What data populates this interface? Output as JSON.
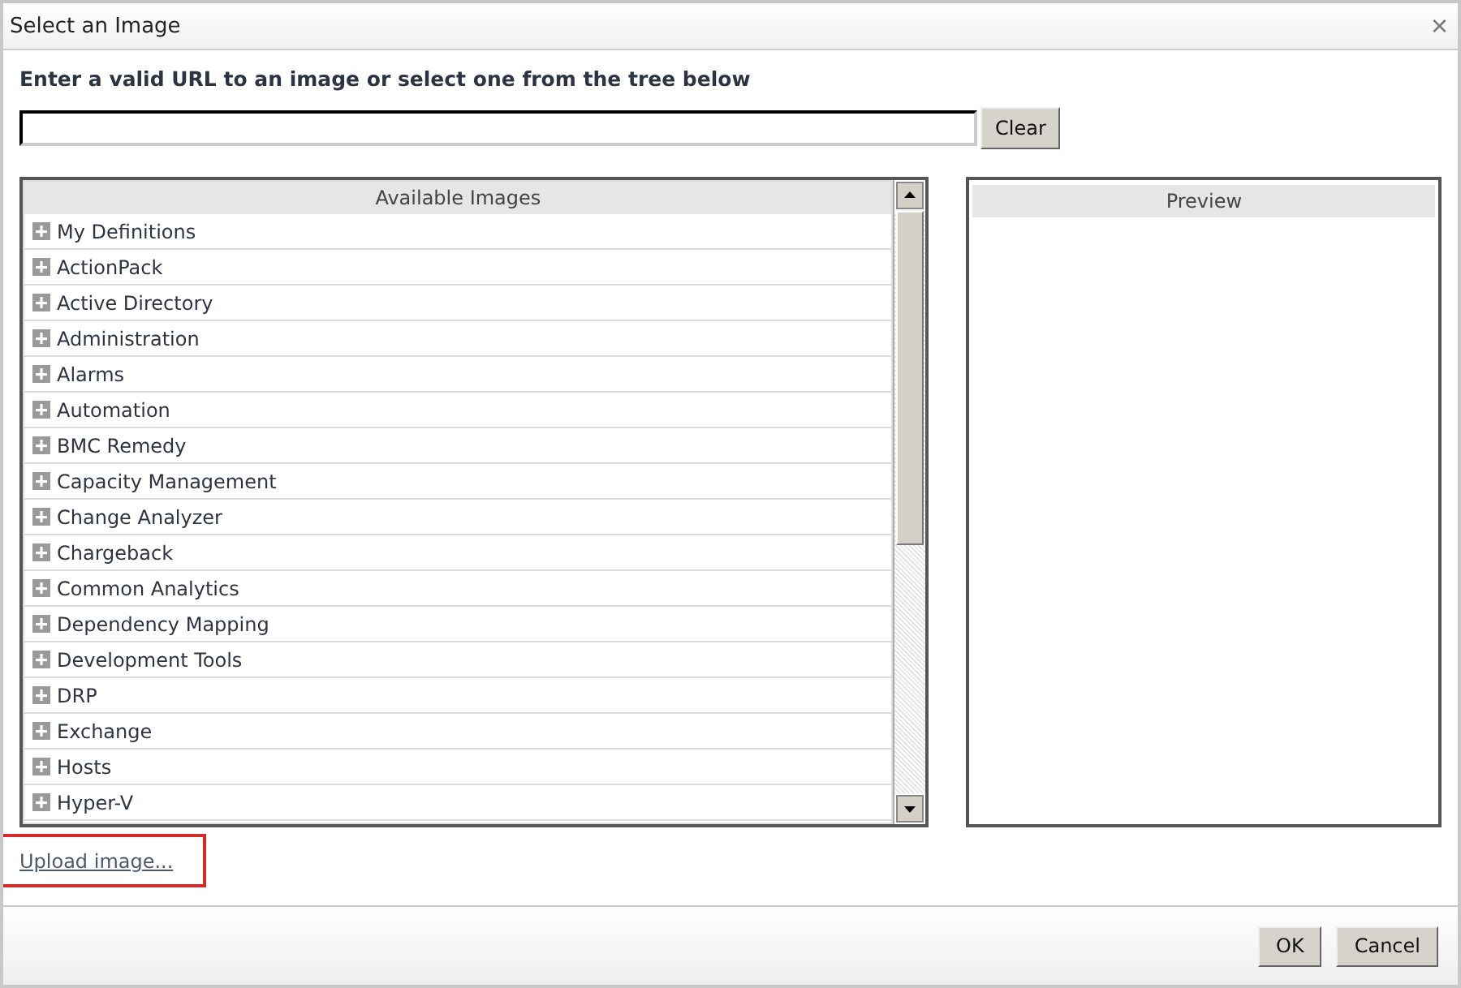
{
  "window": {
    "title": "Select an Image",
    "close": "×"
  },
  "instruction": "Enter a valid URL to an image or select one from the tree below",
  "clear_button": "Clear",
  "tree": {
    "header": "Available Images",
    "items": [
      {
        "label": "My Definitions",
        "expanded": false
      },
      {
        "label": "ActionPack",
        "expanded": false
      },
      {
        "label": "Active Directory",
        "expanded": false
      },
      {
        "label": "Administration",
        "expanded": false
      },
      {
        "label": "Alarms",
        "expanded": false
      },
      {
        "label": "Automation",
        "expanded": false
      },
      {
        "label": "BMC Remedy",
        "expanded": false
      },
      {
        "label": "Capacity Management",
        "expanded": false
      },
      {
        "label": "Change Analyzer",
        "expanded": false
      },
      {
        "label": "Chargeback",
        "expanded": false
      },
      {
        "label": "Common Analytics",
        "expanded": false
      },
      {
        "label": "Dependency Mapping",
        "expanded": false
      },
      {
        "label": "Development Tools",
        "expanded": false
      },
      {
        "label": "DRP",
        "expanded": false
      },
      {
        "label": "Exchange",
        "expanded": false
      },
      {
        "label": "Hosts",
        "expanded": false
      },
      {
        "label": "Hyper-V",
        "expanded": false
      }
    ]
  },
  "preview": {
    "header": "Preview"
  },
  "upload_link": "Upload image...",
  "buttons": [
    "OK",
    "Cancel"
  ]
}
